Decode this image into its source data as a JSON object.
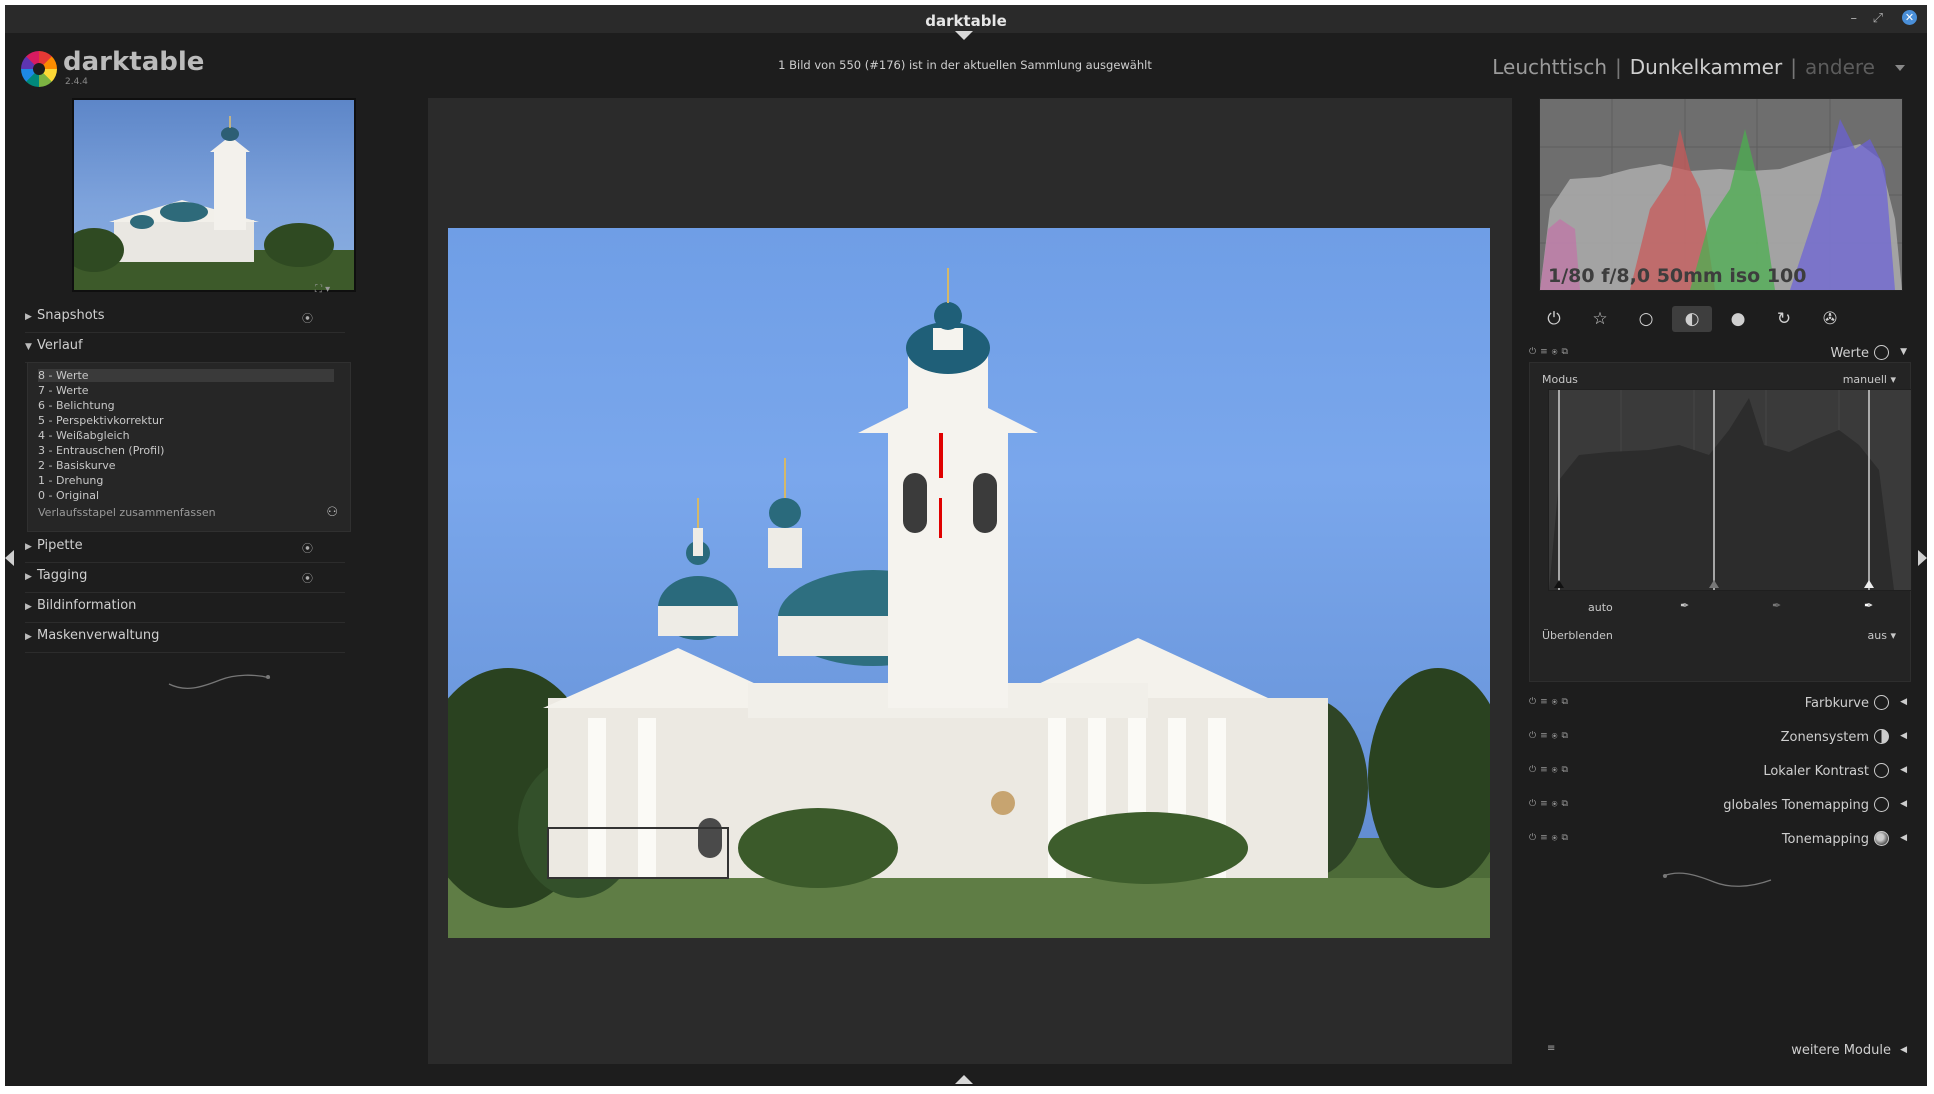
{
  "window": {
    "title": "darktable"
  },
  "app": {
    "name": "darktable",
    "version": "2.4.4"
  },
  "status": {
    "message": "1 Bild von 550 (#176) ist in der aktuellen Sammlung ausgewählt"
  },
  "views": {
    "lighttable": "Leuchttisch",
    "darkroom": "Dunkelkammer",
    "other": "andere",
    "separator": "|"
  },
  "left": {
    "snapshots": "Snapshots",
    "history": {
      "title": "Verlauf",
      "items": [
        "8 - Werte",
        "7 - Werte",
        "6 - Belichtung",
        "5 - Perspektivkorrektur",
        "4 - Weißabgleich",
        "3 - Entrauschen (Profil)",
        "2 - Basiskurve",
        "1 - Drehung",
        "0 - Original"
      ],
      "compress": "Verlaufsstapel zusammenfassen"
    },
    "color_picker": "Pipette",
    "tagging": "Tagging",
    "image_info": "Bildinformation",
    "mask_manager": "Maskenverwaltung"
  },
  "right": {
    "exif": "1/80 f/8,0 50mm iso 100",
    "active_module": {
      "name": "Werte",
      "mode_label": "Modus",
      "mode_value": "manuell",
      "auto_label": "auto",
      "blend_label": "Überblenden",
      "blend_value": "aus"
    },
    "modules": [
      "Farbkurve",
      "Zonensystem",
      "Lokaler Kontrast",
      "globales Tonemapping",
      "Tonemapping"
    ],
    "more_modules": "weitere Module"
  },
  "colors": {
    "accent": "#4a8fd8",
    "histo_red": "#c0504d",
    "histo_green": "#4caf50",
    "histo_blue": "#5a7fd6"
  }
}
